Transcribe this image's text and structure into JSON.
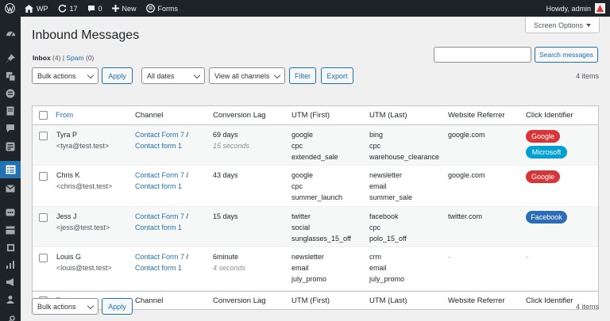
{
  "admin_bar": {
    "site_name": "WP",
    "updates_count": "17",
    "comments_count": "0",
    "new_label": "New",
    "forms_label": "Forms",
    "greeting": "Howdy, admin"
  },
  "admin_menu": {
    "icons": [
      "dashboard-icon",
      "pin-icon",
      "media-icon",
      "forms-icon",
      "pages-icon",
      "comments-icon",
      "forms-alt-icon",
      "inbound-messages-icon",
      "mail-icon",
      "feedback-icon",
      "appearance-icon",
      "plugins-icon",
      "stats-icon",
      "marketing-icon",
      "users-icon",
      "tools-icon"
    ]
  },
  "screen_options": "Screen Options",
  "page_title": "Inbound Messages",
  "views": {
    "inbox_label": "Inbox",
    "inbox_count": "(4)",
    "separator": "|",
    "spam_label": "Spam",
    "spam_count": "(0)"
  },
  "search": {
    "value": "",
    "button": "Search messages"
  },
  "tablenav_top": {
    "bulk_actions": "Bulk actions",
    "apply": "Apply",
    "dates": "All dates",
    "channels": "View all channels",
    "filter": "Filter",
    "export": "Export",
    "items": "4 items"
  },
  "tablenav_bottom": {
    "bulk_actions": "Bulk actions",
    "apply": "Apply",
    "items": "4 items"
  },
  "columns": [
    "From",
    "Channel",
    "Conversion Lag",
    "UTM (First)",
    "UTM (Last)",
    "Website Referrer",
    "Click Identifier"
  ],
  "rows": [
    {
      "name": "Tyra P",
      "email": "<tyra@test.test>",
      "channel1": "Contact Form 7",
      "channel_sep": " /",
      "channel2": "Contact form 1",
      "lag": "69 days",
      "lag_detail": "15 seconds",
      "utm_first": [
        "google",
        "cpc",
        "extended_sale"
      ],
      "utm_last": [
        "bing",
        "cpc",
        "warehouse_clearance"
      ],
      "referrer": "google.com",
      "badges": [
        {
          "label": "Google",
          "color": "#d63638"
        },
        {
          "label": "Microsoft",
          "color": "#00a0d2"
        }
      ]
    },
    {
      "name": "Chris K",
      "email": "<chris@test.test>",
      "channel1": "Contact Form 7",
      "channel_sep": " /",
      "channel2": "Contact form 1",
      "lag": "43 days",
      "lag_detail": "",
      "utm_first": [
        "google",
        "cpc",
        "summer_launch"
      ],
      "utm_last": [
        "newsletter",
        "email",
        "summer_sale"
      ],
      "referrer": "google.com",
      "badges": [
        {
          "label": "Google",
          "color": "#d63638"
        }
      ]
    },
    {
      "name": "Jess J",
      "email": "<jess@test.test>",
      "channel1": "Contact Form 7",
      "channel_sep": " /",
      "channel2": "Contact form 1",
      "lag": "15 days",
      "lag_detail": "",
      "utm_first": [
        "twitter",
        "social",
        "sunglasses_15_off"
      ],
      "utm_last": [
        "facebook",
        "cpc",
        "polo_15_off"
      ],
      "referrer": "twitter.com",
      "badges": [
        {
          "label": "Facebook",
          "color": "#2d6db5"
        }
      ]
    },
    {
      "name": "Louis G",
      "email": "<louis@test.test>",
      "channel1": "Contact Form 7",
      "channel_sep": " /",
      "channel2": "Contact form 1",
      "lag": "6minute",
      "lag_detail": "4 seconds",
      "utm_first": [
        "newsletter",
        "email",
        "july_promo"
      ],
      "utm_last": [
        "crm",
        "email",
        "july_promo"
      ],
      "referrer": "-",
      "click_id": "-",
      "badges": []
    }
  ],
  "colors": {
    "admin_bar": "#1d2327",
    "accent": "#2271b1",
    "google": "#d63638",
    "microsoft": "#00a0d2",
    "facebook": "#2d6db5"
  }
}
